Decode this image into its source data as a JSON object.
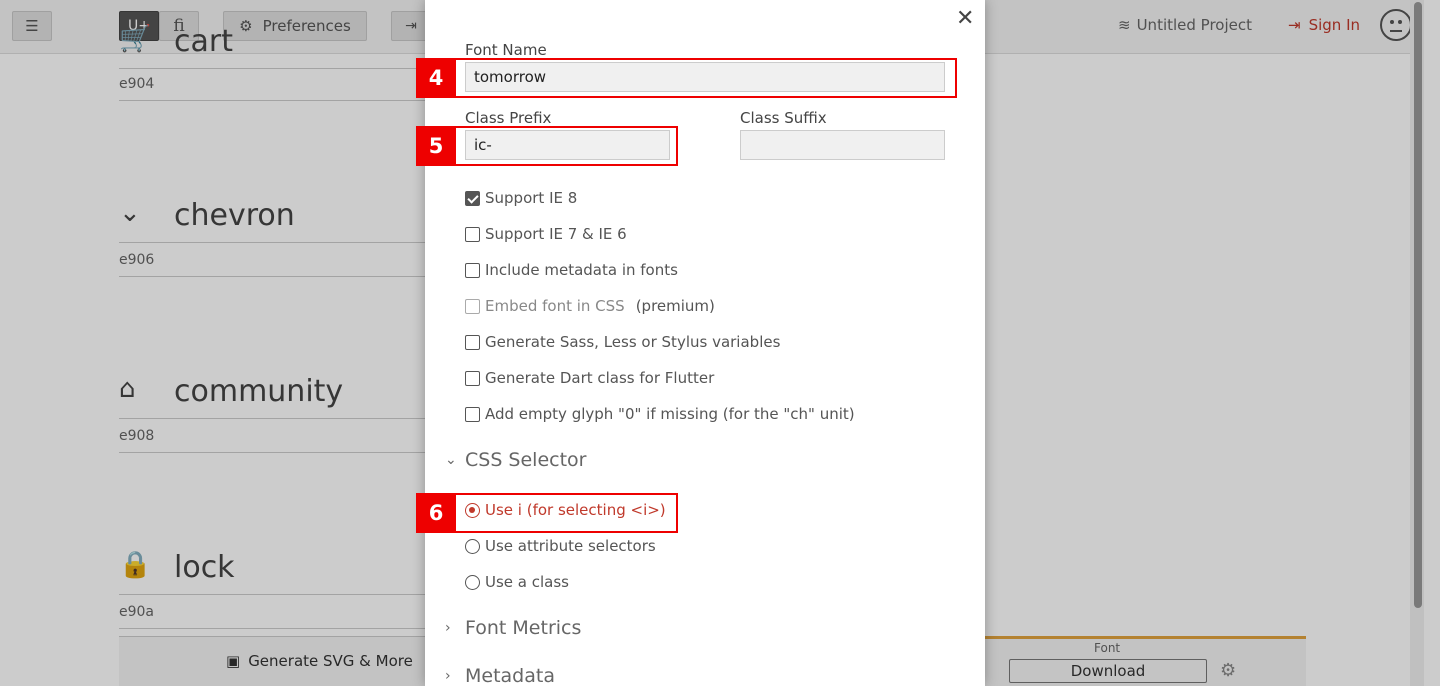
{
  "background": {
    "toolbar": {
      "menu_icon": "hamburger-icon",
      "unicode_label": "U+",
      "ligature_label": "fi",
      "preferences_label": "Preferences",
      "preferences_icon": "gear-icon",
      "project_label": "Untitled Project",
      "signin_label": "Sign In"
    },
    "glyphs": [
      {
        "name": "cart",
        "code": "e904",
        "icon": "cart-icon"
      },
      {
        "name": "chevron",
        "code": "e906",
        "icon": "chevron-down-icon"
      },
      {
        "name": "community",
        "code": "e908",
        "icon": "storefront-icon"
      },
      {
        "name": "lock",
        "code": "e90a",
        "icon": "lock-icon"
      }
    ],
    "bottom": {
      "generate_label": "Generate SVG & More",
      "font_label": "Font",
      "download_label": "Download"
    }
  },
  "modal": {
    "font_name_label": "Font Name",
    "font_name_value": "tomorrow",
    "class_prefix_label": "Class Prefix",
    "class_prefix_value": "ic-",
    "class_suffix_label": "Class Suffix",
    "class_suffix_value": "",
    "options": [
      {
        "label": "Support IE 8",
        "checked": true
      },
      {
        "label": "Support IE 7 & IE 6",
        "checked": false
      },
      {
        "label": "Include metadata in fonts",
        "checked": false
      },
      {
        "label": "Embed font in CSS",
        "checked": false,
        "suffix": "(premium)"
      },
      {
        "label": "Generate Sass, Less or Stylus variables",
        "checked": false
      },
      {
        "label": "Generate Dart class for Flutter",
        "checked": false
      },
      {
        "label": "Add empty glyph \"0\" if missing (for the \"ch\" unit)",
        "checked": false
      }
    ],
    "css_selector_label": "CSS Selector",
    "selectors": [
      {
        "label": "Use i (for selecting <i>)",
        "selected": true
      },
      {
        "label": "Use attribute selectors",
        "selected": false
      },
      {
        "label": "Use a class",
        "selected": false
      }
    ],
    "font_metrics_label": "Font Metrics",
    "metadata_label": "Metadata"
  },
  "annotations": [
    "4",
    "5",
    "6"
  ],
  "colors": {
    "accent": "#c0392b",
    "annotation": "#ee0000",
    "download_underline": "#e2a33e"
  }
}
